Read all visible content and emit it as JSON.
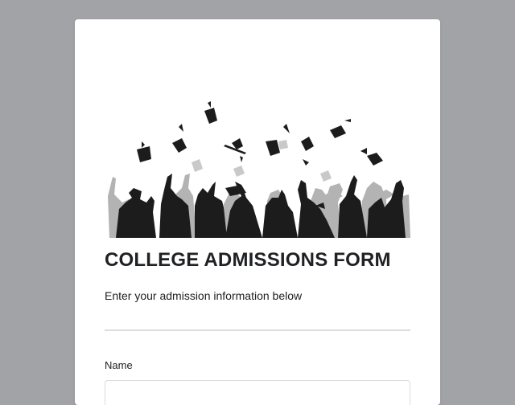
{
  "form": {
    "title": "COLLEGE ADMISSIONS FORM",
    "description": "Enter your admission information below",
    "fields": [
      {
        "label": "Name",
        "value": "",
        "placeholder": ""
      }
    ]
  },
  "hero": {
    "icon": "graduation-caps-image"
  },
  "colors": {
    "page_background": "#a2a3a7",
    "card_background": "#ffffff",
    "text": "#202124",
    "divider": "#dadce0",
    "silhouette_dark": "#1c1c1c",
    "silhouette_light": "#b3b3b3"
  }
}
